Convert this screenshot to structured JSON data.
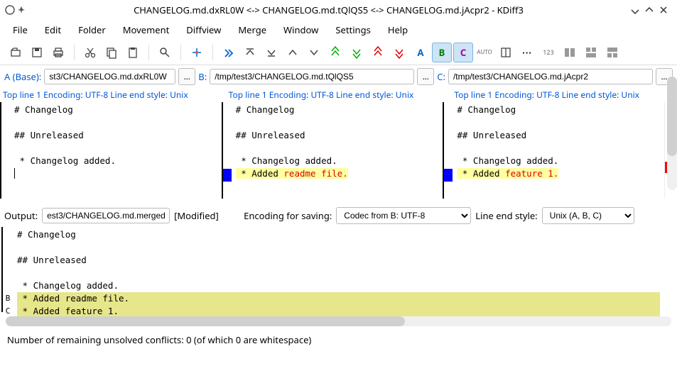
{
  "title": "CHANGELOG.md.dxRL0W <-> CHANGELOG.md.tQlQS5 <-> CHANGELOG.md.jAcpr2 - KDiff3",
  "menus": [
    "File",
    "Edit",
    "Folder",
    "Movement",
    "Diffview",
    "Merge",
    "Window",
    "Settings",
    "Help"
  ],
  "toolbar": {
    "letters": {
      "a": "A",
      "b": "B",
      "c": "C"
    },
    "auto": "AUTO",
    "num": "123"
  },
  "files": {
    "a_label": "A (Base):",
    "a_path": "st3/CHANGELOG.md.dxRL0W",
    "b_label": "B:",
    "b_path": "/tmp/test3/CHANGELOG.md.tQlQS5",
    "c_label": "C:",
    "c_path": "/tmp/test3/CHANGELOG.md.jAcpr2",
    "browse": "..."
  },
  "info": {
    "a": "Top line 1 Encoding: UTF-8 Line end style: Unix",
    "b": "Top line 1 Encoding: UTF-8 Line end style: Unix",
    "c": "Top line 1 Encoding: UTF-8 Line end style: Unix"
  },
  "content": {
    "common": "# Changelog\n\n## Unreleased\n\n * Changelog added.",
    "b_hl_prefix": " * Added ",
    "b_hl_red": "readme file.",
    "c_hl_prefix": " * Added ",
    "c_hl_red": "feature 1."
  },
  "output": {
    "label": "Output:",
    "path": "est3/CHANGELOG.md.merged",
    "modified": "[Modified]",
    "enc_label": "Encoding for saving:",
    "enc_value": "Codec from B: UTF-8",
    "le_label": "Line end style:",
    "le_value": "Unix (A, B, C)",
    "gutter_b": "B",
    "gutter_c": "C",
    "common": "# Changelog\n\n## Unreleased\n\n * Changelog added.",
    "merge_b": " * Added readme file.",
    "merge_c": " * Added feature 1."
  },
  "status": "Number of remaining unsolved conflicts: 0 (of which 0 are whitespace)"
}
